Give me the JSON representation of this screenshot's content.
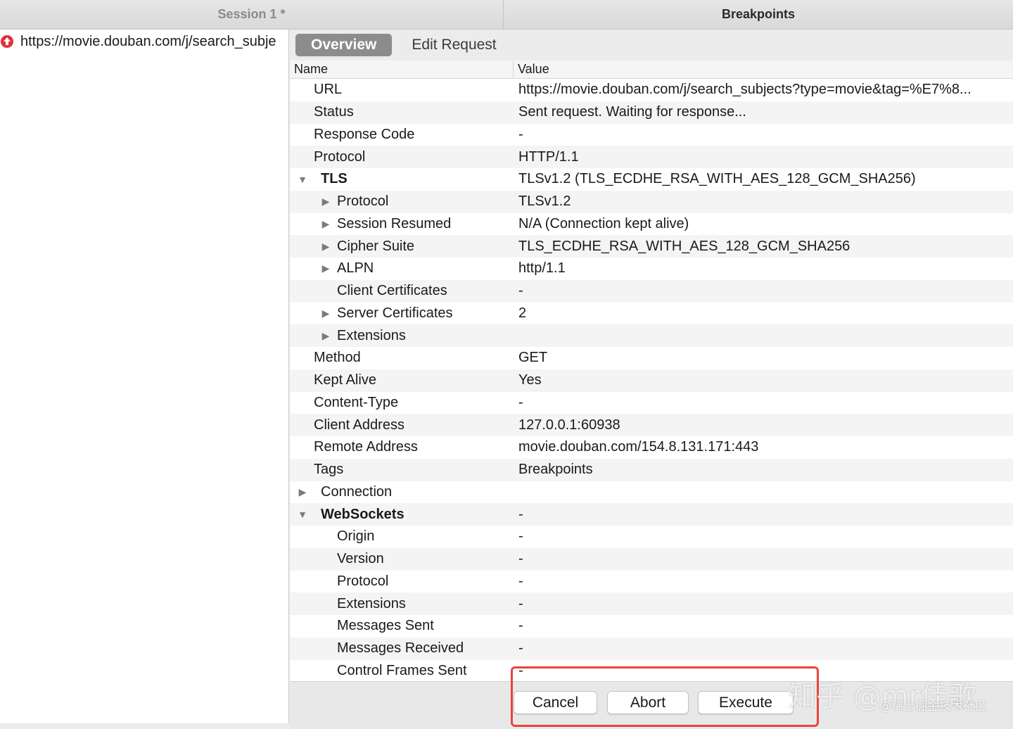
{
  "titlebar": {
    "left_title": "Session 1 *",
    "right_title": "Breakpoints"
  },
  "session": {
    "request_url": "https://movie.douban.com/j/search_subje"
  },
  "tabs": [
    {
      "label": "Overview",
      "active": true
    },
    {
      "label": "Edit Request",
      "active": false
    }
  ],
  "table": {
    "col_name": "Name",
    "col_value": "Value",
    "rows": [
      {
        "name": "URL",
        "value": "https://movie.douban.com/j/search_subjects?type=movie&tag=%E7%8..."
      },
      {
        "name": "Status",
        "value": "Sent request. Waiting for response..."
      },
      {
        "name": "Response Code",
        "value": "-"
      },
      {
        "name": "Protocol",
        "value": "HTTP/1.1"
      },
      {
        "name": "TLS",
        "value": "TLSv1.2 (TLS_ECDHE_RSA_WITH_AES_128_GCM_SHA256)"
      },
      {
        "name": "Protocol",
        "value": "TLSv1.2"
      },
      {
        "name": "Session Resumed",
        "value": "N/A (Connection kept alive)"
      },
      {
        "name": "Cipher Suite",
        "value": "TLS_ECDHE_RSA_WITH_AES_128_GCM_SHA256"
      },
      {
        "name": "ALPN",
        "value": "http/1.1"
      },
      {
        "name": "Client Certificates",
        "value": "-"
      },
      {
        "name": "Server Certificates",
        "value": "2"
      },
      {
        "name": "Extensions",
        "value": ""
      },
      {
        "name": "Method",
        "value": "GET"
      },
      {
        "name": "Kept Alive",
        "value": "Yes"
      },
      {
        "name": "Content-Type",
        "value": "-"
      },
      {
        "name": "Client Address",
        "value": "127.0.0.1:60938"
      },
      {
        "name": "Remote Address",
        "value": "movie.douban.com/154.8.131.171:443"
      },
      {
        "name": "Tags",
        "value": "Breakpoints"
      },
      {
        "name": "Connection",
        "value": ""
      },
      {
        "name": "WebSockets",
        "value": "-"
      },
      {
        "name": "Origin",
        "value": "-"
      },
      {
        "name": "Version",
        "value": "-"
      },
      {
        "name": "Protocol",
        "value": "-"
      },
      {
        "name": "Extensions",
        "value": "-"
      },
      {
        "name": "Messages Sent",
        "value": "-"
      },
      {
        "name": "Messages Received",
        "value": "-"
      },
      {
        "name": "Control Frames Sent",
        "value": "-"
      }
    ]
  },
  "buttons": {
    "cancel": "Cancel",
    "abort": "Abort",
    "execute": "Execute"
  },
  "watermark": {
    "main": "知乎 @mr佳歌",
    "sub": "@稀土掘金技术社区"
  },
  "colors": {
    "highlight": "#e8453c",
    "active_tab": "#8c8c8c",
    "upload_icon": "#e0313a"
  },
  "icons": {
    "request": "upload-arrow-icon",
    "expanded": "triangle-down-icon",
    "collapsed": "triangle-right-icon"
  }
}
